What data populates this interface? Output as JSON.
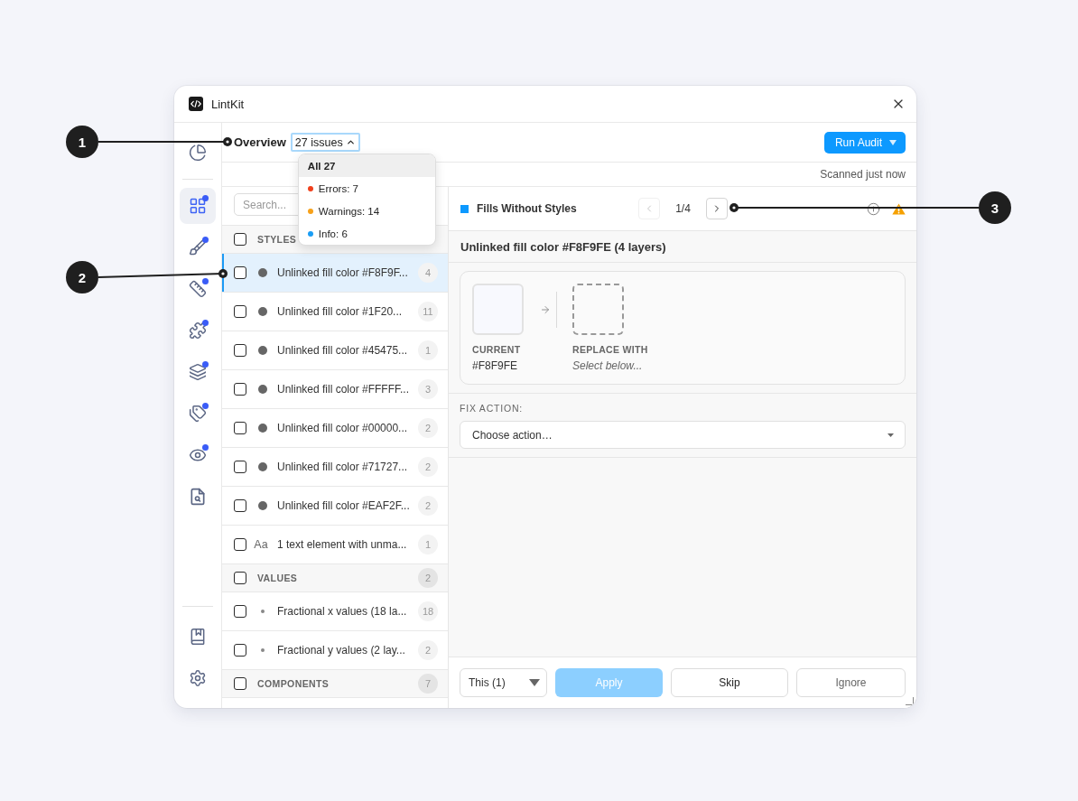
{
  "window": {
    "title": "LintKit"
  },
  "sidebar": {
    "groups": [
      [
        {
          "selected": false,
          "dot": false
        }
      ],
      [
        {
          "selected": true,
          "dot": true
        },
        {
          "selected": false,
          "dot": true
        },
        {
          "selected": false,
          "dot": true
        },
        {
          "selected": false,
          "dot": true
        },
        {
          "selected": false,
          "dot": true
        },
        {
          "selected": false,
          "dot": true
        },
        {
          "selected": false,
          "dot": true
        },
        {
          "selected": false,
          "dot": false
        }
      ],
      [
        {
          "selected": false,
          "dot": false
        },
        {
          "selected": false,
          "dot": false
        }
      ]
    ]
  },
  "toolbar": {
    "title": "Overview",
    "filter": {
      "label": "27 issues",
      "expanded": true,
      "options": [
        {
          "label": "All 27",
          "selected": true
        },
        {
          "label": "Errors: 7",
          "selected": false,
          "color": "#f0401c"
        },
        {
          "label": "Warnings: 14",
          "selected": false,
          "color": "#f7a11a"
        },
        {
          "label": "Info: 6",
          "selected": false,
          "color": "#1a9df5"
        }
      ]
    },
    "run_button": "Run Audit"
  },
  "status": "Scanned just now",
  "search": {
    "placeholder": "Search..."
  },
  "sections": [
    {
      "title": "STYLES",
      "checked": false,
      "items": [
        {
          "kind": "fill",
          "label": "Unlinked fill color #F8F9F...",
          "count": "4",
          "checked": false,
          "selected": true
        },
        {
          "kind": "fill",
          "label": "Unlinked fill color #1F20...",
          "count": "11",
          "checked": false,
          "selected": false
        },
        {
          "kind": "fill",
          "label": "Unlinked fill color #45475...",
          "count": "1",
          "checked": false,
          "selected": false
        },
        {
          "kind": "fill",
          "label": "Unlinked fill color #FFFFF...",
          "count": "3",
          "checked": false,
          "selected": false
        },
        {
          "kind": "fill",
          "label": "Unlinked fill color #00000...",
          "count": "2",
          "checked": false,
          "selected": false
        },
        {
          "kind": "fill",
          "label": "Unlinked fill color #71727...",
          "count": "2",
          "checked": false,
          "selected": false
        },
        {
          "kind": "fill",
          "label": "Unlinked fill color #EAF2F...",
          "count": "2",
          "checked": false,
          "selected": false
        },
        {
          "kind": "text",
          "glyph": "Aa",
          "label": "1 text element with unma...",
          "count": "1",
          "checked": false,
          "selected": false
        }
      ]
    },
    {
      "title": "VALUES",
      "count": "2",
      "checked": false,
      "items": [
        {
          "kind": "value",
          "label": "Fractional x values (18 la...",
          "count": "18",
          "checked": false,
          "selected": false
        },
        {
          "kind": "value",
          "label": "Fractional y values (2 lay...",
          "count": "2",
          "checked": false,
          "selected": false
        }
      ]
    },
    {
      "title": "COMPONENTS",
      "count": "7",
      "checked": false
    }
  ],
  "detail": {
    "rule": {
      "title": "Fills Without Styles",
      "color": "#0d99ff"
    },
    "pager": {
      "position": "1/4",
      "prev_disabled": true,
      "next_disabled": false
    },
    "issue_title": "Unlinked fill color #F8F9FE (4 layers)",
    "current": {
      "label": "CURRENT",
      "value": "#F8F9FE",
      "color": "#f8f9fe"
    },
    "replacement": {
      "label": "REPLACE WITH",
      "hint": "Select below..."
    },
    "fix_action": {
      "label": "FIX ACTION:",
      "placeholder": "Choose action…"
    }
  },
  "footer": {
    "scope": "This (1)",
    "buttons": [
      {
        "label": "Apply",
        "kind": "primary",
        "disabled": true
      },
      {
        "label": "Skip",
        "kind": "secondary",
        "disabled": false
      },
      {
        "label": "Ignore",
        "kind": "subtle",
        "disabled": false
      }
    ]
  },
  "callouts": [
    {
      "number": "1"
    },
    {
      "number": "2"
    },
    {
      "number": "3"
    }
  ]
}
